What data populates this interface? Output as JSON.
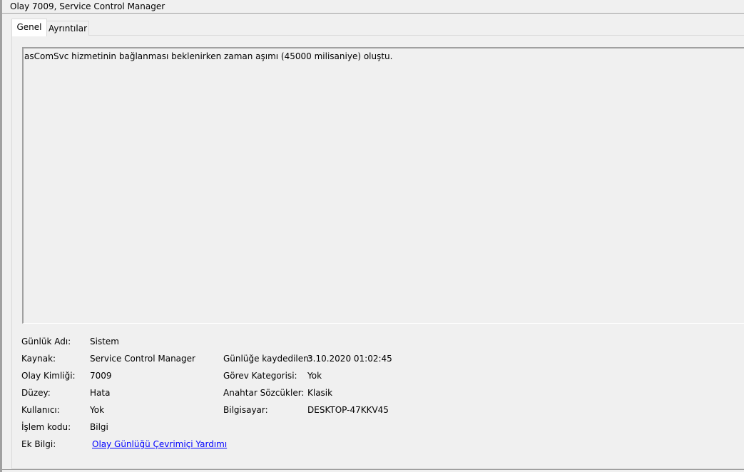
{
  "window": {
    "title": "Olay 7009, Service Control Manager"
  },
  "tabs": [
    {
      "label": "Genel",
      "selected": true
    },
    {
      "label": "Ayrıntılar",
      "selected": false
    }
  ],
  "description": "asComSvc hizmetinin bağlanması beklenirken zaman aşımı (45000 milisaniye) oluştu.",
  "properties": {
    "log_name_label": "Günlük Adı:",
    "log_name_value": "Sistem",
    "source_label": "Kaynak:",
    "source_value": "Service Control Manager",
    "logged_label": "Günlüğe kaydedilen:",
    "logged_value": "3.10.2020 01:02:45",
    "event_id_label": "Olay Kimliği:",
    "event_id_value": "7009",
    "task_category_label": "Görev Kategorisi:",
    "task_category_value": "Yok",
    "level_label": "Düzey:",
    "level_value": "Hata",
    "keywords_label": "Anahtar Sözcükler:",
    "keywords_value": "Klasik",
    "user_label": "Kullanıcı:",
    "user_value": "Yok",
    "computer_label": "Bilgisayar:",
    "computer_value": "DESKTOP-47KKV45",
    "opcode_label": "İşlem kodu:",
    "opcode_value": "Bilgi",
    "more_info_label": "Ek Bilgi:",
    "more_info_link": "Olay Günlüğü Çevrimiçi Yardımı"
  }
}
